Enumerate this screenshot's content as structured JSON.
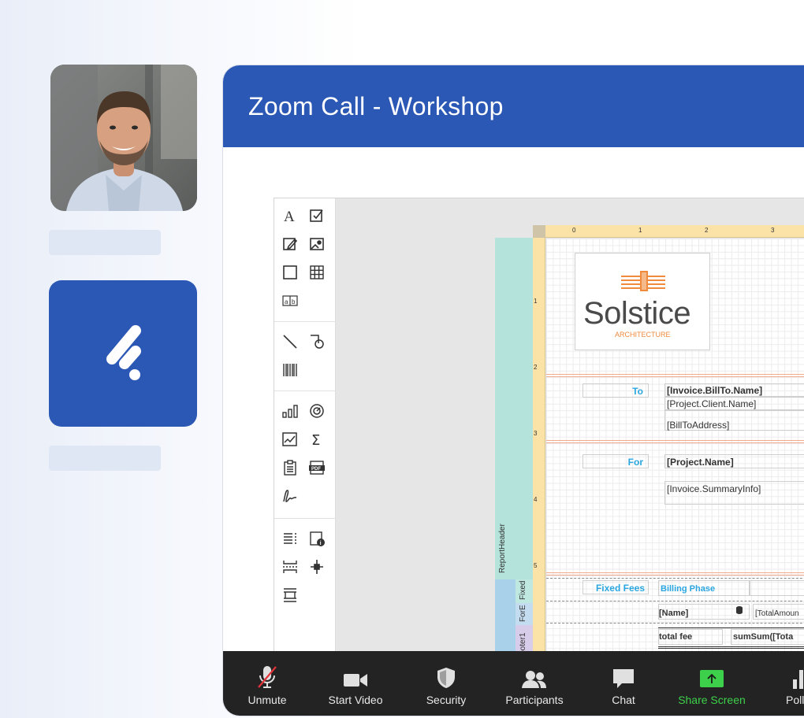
{
  "meeting": {
    "title": "Zoom Call - Workshop"
  },
  "participant": {
    "avatar_icon": "participant-photo"
  },
  "brand": {
    "logo_icon": "brand-logo-icon",
    "accent": "#2b57b5"
  },
  "designer": {
    "toolbox_icons": [
      "label-icon",
      "checkbox-icon",
      "richtext-icon",
      "picture-icon",
      "panel-icon",
      "table-icon",
      "character-comb-icon",
      "line-icon",
      "shape-icon",
      "barcode-icon",
      "chart-icon",
      "gauge-icon",
      "sparkline-icon",
      "summary-icon",
      "toc-icon",
      "pdf-content-icon",
      "signature-icon",
      "cross-tab-icon",
      "page-info-icon",
      "page-break-icon",
      "cross-band-line-icon",
      "subreport-icon"
    ],
    "ruler_ticks_top": [
      "0",
      "1",
      "2",
      "3"
    ],
    "ruler_ticks_left": [
      "1",
      "2",
      "3",
      "4",
      "5"
    ],
    "report": {
      "company_name": "Solstice",
      "company_tagline": "ARCHITECTURE",
      "to_label": "To",
      "bill_to_name": "[Invoice.BillTo.Name]",
      "client_name": "[Project.Client.Name]",
      "bill_to_address": "[BillToAddress]",
      "for_label": "For",
      "project_name": "[Project.Name]",
      "summary_info": "[Invoice.SummaryInfo]",
      "fixed_fees": "Fixed Fees",
      "billing_phase": "Billing Phase",
      "fee_col": "Fe",
      "name_field": "[Name]",
      "total_amount": "[TotalAmoun",
      "total_fee": "total fee",
      "sum_field": "sumSum([Tota"
    },
    "bands": {
      "report_header": "ReportHeader",
      "fixed": "Fixed",
      "for_e": "ForE",
      "footer": "Footer1",
      "fee_report": "eeReport"
    }
  },
  "zoom_toolbar": {
    "items": [
      {
        "label": "Unmute",
        "icon": "muted-microphone-icon"
      },
      {
        "label": "Start Video",
        "icon": "video-camera-icon"
      },
      {
        "label": "Security",
        "icon": "shield-icon"
      },
      {
        "label": "Participants",
        "icon": "participants-icon"
      },
      {
        "label": "Chat",
        "icon": "chat-bubble-icon"
      },
      {
        "label": "Share Screen",
        "icon": "share-screen-icon",
        "color": "#3dd04a"
      },
      {
        "label": "Polls",
        "icon": "polls-icon"
      }
    ]
  }
}
